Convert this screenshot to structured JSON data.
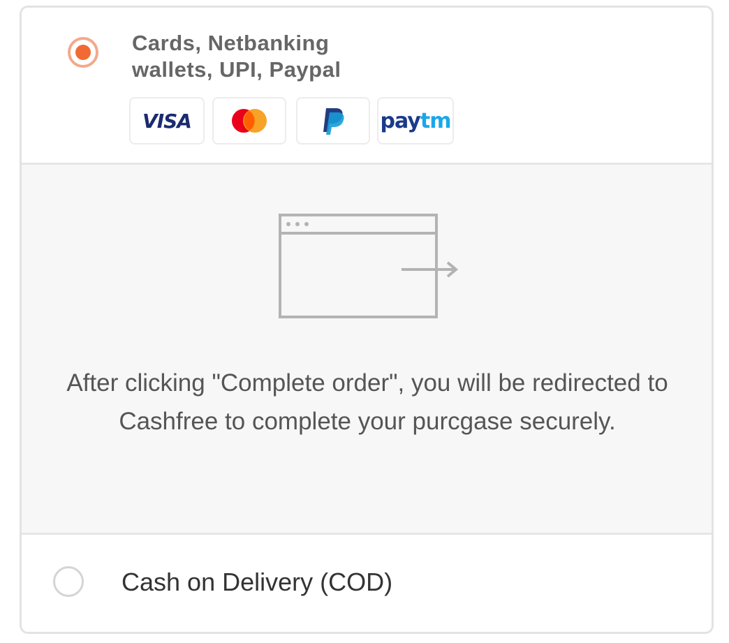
{
  "payment_options": {
    "online": {
      "selected": true,
      "label_line1": "Cards, Netbanking",
      "label_line2": "wallets, UPI, Paypal",
      "logos": [
        {
          "name": "visa",
          "text": "VISA"
        },
        {
          "name": "mastercard"
        },
        {
          "name": "paypal"
        },
        {
          "name": "paytm",
          "text_a": "pay",
          "text_b": "tm"
        }
      ]
    },
    "redirect_panel": {
      "icon": "browser-window-redirect-icon",
      "message": "After clicking \"Complete order\", you will be redirected to Cashfree to complete your purcgase securely."
    },
    "cod": {
      "selected": false,
      "label": "Cash on Delivery (COD)"
    }
  },
  "colors": {
    "accent": "#f26a33",
    "accent_ring": "#f4a98a",
    "panel_bg": "#f7f7f7",
    "border": "#e3e3e3"
  }
}
